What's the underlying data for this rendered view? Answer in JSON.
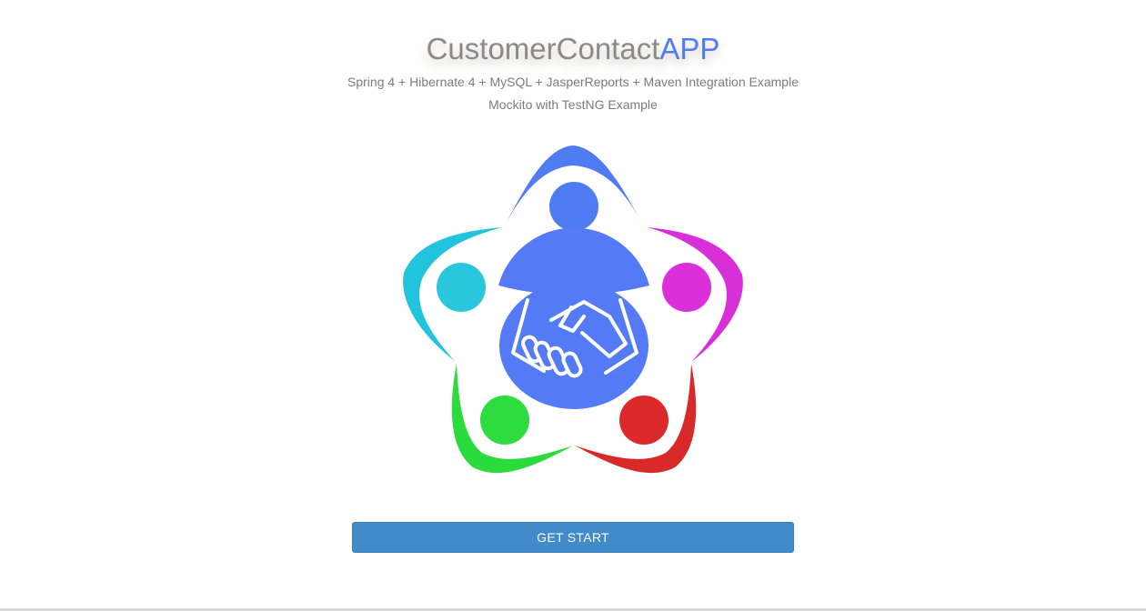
{
  "header": {
    "title_part_1": "CustomerContact",
    "title_part_2": "APP",
    "subtitle_line_1": "Spring 4 + Hibernate 4 + MySQL + JasperReports + Maven Integration Example",
    "subtitle_line_2": "Mockito with TestNG Example"
  },
  "logo": {
    "icon": "team-handshake-logo-icon",
    "colors": {
      "top": "#4f7cf3",
      "left": "#22c3dc",
      "right": "#d92fd9",
      "bottom_left": "#2bdb3c",
      "bottom_right": "#d92a2a",
      "center": "#557af5"
    }
  },
  "actions": {
    "start_label": "GET START"
  },
  "colors": {
    "accent": "#4f7cf3",
    "button": "#428bca"
  }
}
